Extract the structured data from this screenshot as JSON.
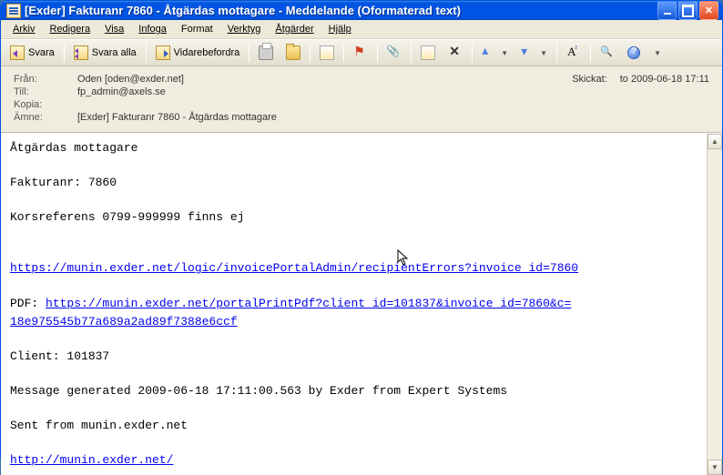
{
  "window": {
    "title": "[Exder] Fakturanr 7860 - Åtgärdas mottagare - Meddelande (Oformaterad text)"
  },
  "menu": {
    "arkiv": "Arkiv",
    "redigera": "Redigera",
    "visa": "Visa",
    "infoga": "Infoga",
    "format": "Format",
    "verktyg": "Verktyg",
    "atgarder": "Åtgärder",
    "hjalp": "Hjälp"
  },
  "toolbar": {
    "svara": "Svara",
    "svara_alla": "Svara alla",
    "vidarebefordra": "Vidarebefordra"
  },
  "headers": {
    "from_label": "Från:",
    "from_value": "Oden [oden@exder.net]",
    "to_label": "Till:",
    "to_value": "fp_admin@axels.se",
    "cc_label": "Kopia:",
    "cc_value": "",
    "subject_label": "Ämne:",
    "subject_value": "[Exder] Fakturanr 7860 - Åtgärdas mottagare",
    "sent_label": "Skickat:",
    "sent_value": "to 2009-06-18 17:11"
  },
  "body": {
    "line1": "Åtgärdas mottagare",
    "line2": "Fakturanr: 7860",
    "line3": "Korsreferens 0799-999999 finns ej",
    "link1": "https://munin.exder.net/logic/invoicePortalAdmin/recipientErrors?invoice_id=7860",
    "pdf_label": "PDF: ",
    "link2a": "https://munin.exder.net/portalPrintPdf?client_id=101837&invoice_id=7860&c=",
    "link2b": "18e975545b77a689a2ad89f7388e6ccf",
    "line_client": "Client: 101837",
    "line_msg": "Message generated 2009-06-18 17:11:00.563 by Exder from Expert Systems",
    "line_sent": "Sent from munin.exder.net",
    "link3": "http://munin.exder.net/"
  }
}
